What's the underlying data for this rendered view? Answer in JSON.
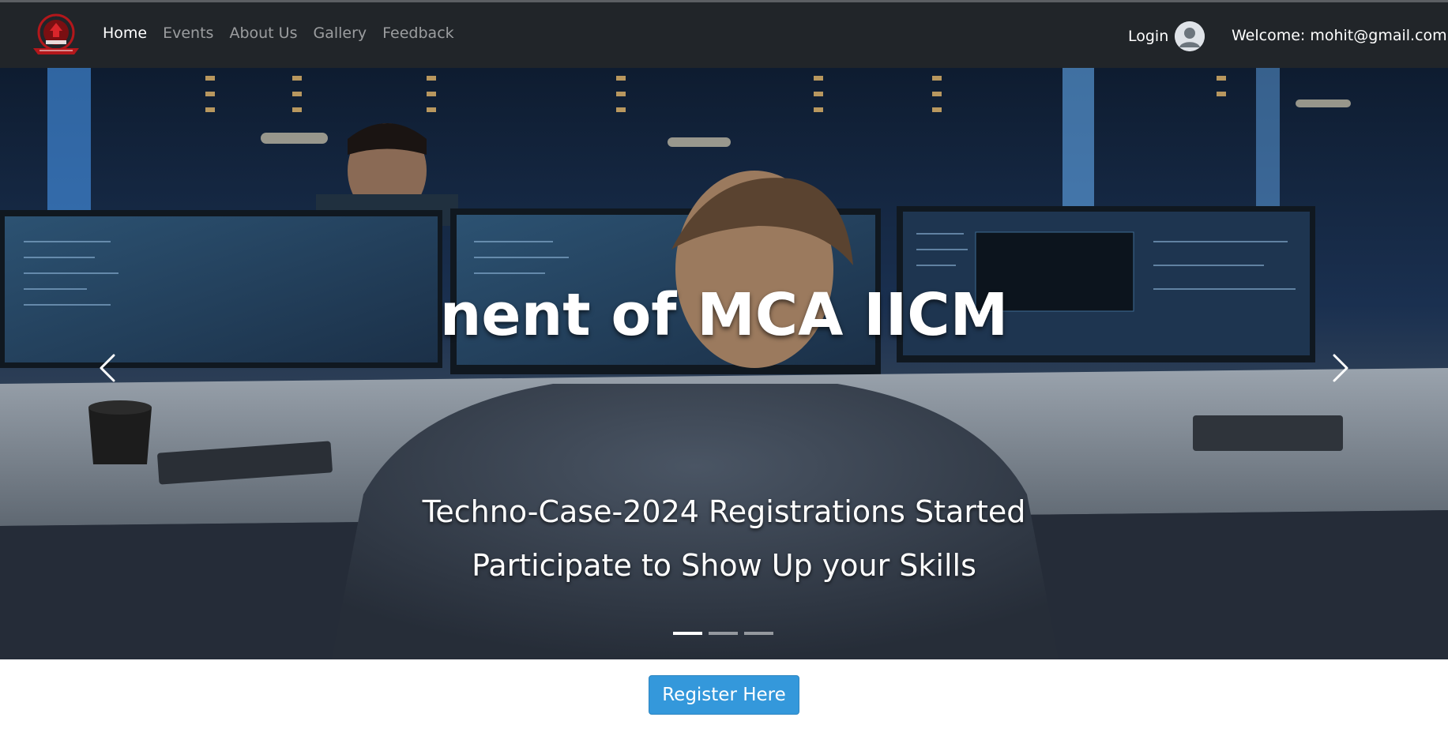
{
  "navbar": {
    "links": [
      {
        "label": "Home",
        "active": true
      },
      {
        "label": "Events",
        "active": false
      },
      {
        "label": "About Us",
        "active": false
      },
      {
        "label": "Gallery",
        "active": false
      },
      {
        "label": "Feedback",
        "active": false
      }
    ],
    "login_label": "Login",
    "welcome_text": "Welcome: mohit@gmail.com",
    "logo_icon": "college-emblem-logo",
    "avatar_icon": "user-avatar-icon"
  },
  "hero": {
    "title": "nent of MCA IICM",
    "caption_line1": "Techno-Case-2024 Registrations Started",
    "caption_line2": "Participate to Show Up your Skills",
    "prev_icon": "chevron-left-icon",
    "next_icon": "chevron-right-icon",
    "slide_count": 3,
    "active_slide": 1
  },
  "register_button": "Register Here",
  "colors": {
    "navbar_bg": "#212529",
    "nav_link_active": "#ffffff",
    "nav_link_inactive": "#9a9da0",
    "register_bg": "#3498db",
    "logo_red": "#b3171b"
  }
}
